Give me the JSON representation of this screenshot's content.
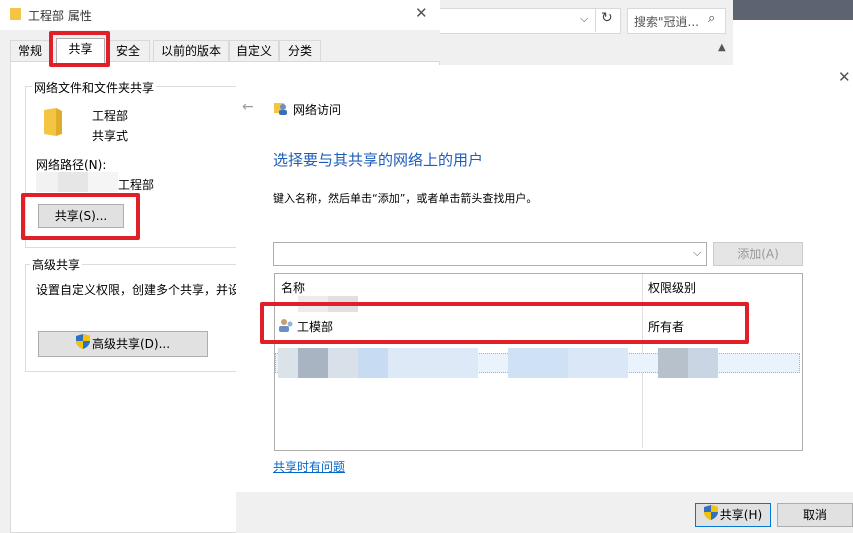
{
  "props": {
    "title": "工程部 属性",
    "tabs": [
      "常规",
      "共享",
      "安全",
      "以前的版本",
      "自定义",
      "分类"
    ],
    "active_tab": "共享",
    "net_share_group": "网络文件和文件夹共享",
    "folder_name": "工程部",
    "folder_state": "共享式",
    "net_path_label": "网络路径(N):",
    "net_path_value": "工程部",
    "share_button": "共享(S)...",
    "adv_group": "高级共享",
    "adv_desc": "设置自定义权限，创建多个共享，并设",
    "adv_button": "高级共享(D)..."
  },
  "explorer": {
    "search_placeholder": "搜索\"冠逍...",
    "icons": [
      "chevron-down-icon",
      "refresh-icon",
      "search-icon",
      "scroll-up-icon"
    ]
  },
  "network_access": {
    "title": "网络访问",
    "heading": "选择要与其共享的网络上的用户",
    "instruction": "键入名称，然后单击“添加”，或者单击箭头查找用户。",
    "add_button": "添加(A)",
    "columns": [
      "名称",
      "权限级别"
    ],
    "users": [
      {
        "name": "工模部",
        "level": "所有者"
      }
    ],
    "trouble_link": "共享时有问题",
    "share_button": "共享(H)",
    "cancel_button": "取消"
  },
  "colors": {
    "accent_blue": "#0066cc",
    "heading_blue": "#1e5db8",
    "highlight_red": "#e01f26",
    "folder_yellow": "#f4c542",
    "shield_blue": "#2f6fc5",
    "shield_yellow": "#f5c400"
  }
}
